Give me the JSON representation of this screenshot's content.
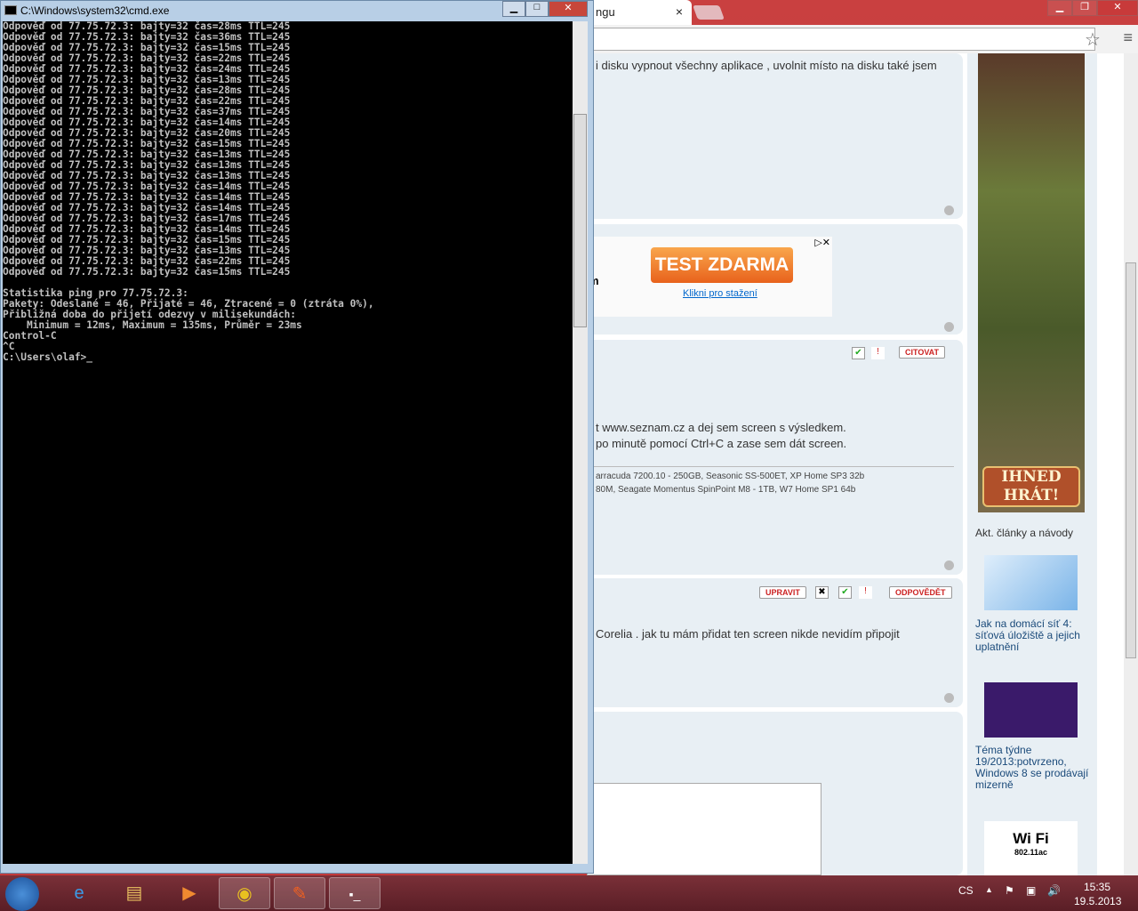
{
  "browser": {
    "tab_title": "ngu",
    "tab_close": "×",
    "post1_text": "i disku vypnout všechny aplikace , uvolnit místo na disku také jsem",
    "ad": {
      "button": "TEST ZDARMA",
      "link": "Klikni pro stažení",
      "partial": "m"
    },
    "post2": {
      "line1": "t www.seznam.cz a dej sem screen s výsledkem.",
      "line2": "po minutě pomocí Ctrl+C a zase sem dát screen.",
      "sig1": "arracuda 7200.10 - 250GB, Seasonic SS-500ET, XP Home SP3 32b",
      "sig2": "80M, Seagate Momentus SpinPoint M8 - 1TB, W7 Home SP1 64b",
      "quote": "CITOVAT"
    },
    "post3": {
      "text": "Corelia . jak tu mám přidat ten screen nikde nevidím připojit",
      "edit": "UPRAVIT",
      "reply": "ODPOVĚDĚT"
    },
    "sidebar": {
      "game_button": "IHNED HRÁT!",
      "heading": "Akt. články a návody",
      "articles": [
        "Jak na domácí síť 4: síťová úložiště a jejich uplatnění",
        "Téma týdne 19/2013:potvrzeno, Windows 8 se prodávají mizerně"
      ],
      "wifi": "Wi Fi",
      "wifi_sub": "802.11ac"
    }
  },
  "cmd": {
    "title": "C:\\Windows\\system32\\cmd.exe",
    "ip": "77.75.72.3",
    "times": [
      28,
      36,
      15,
      22,
      24,
      13,
      28,
      22,
      37,
      14,
      20,
      15,
      13,
      13,
      13,
      14,
      14,
      14,
      17,
      14,
      15,
      13,
      22,
      15
    ],
    "tail": [
      "",
      "Statistika ping pro 77.75.72.3:",
      "Pakety: Odeslané = 46, Přijaté = 46, Ztracené = 0 (ztráta 0%),",
      "Přibližná doba do přijetí odezvy v milisekundách:",
      "    Minimum = 12ms, Maximum = 135ms, Průměr = 23ms",
      "Control-C",
      "^C",
      "C:\\Users\\olaf>_"
    ]
  },
  "taskbar": {
    "lang": "CS",
    "time": "15:35",
    "date": "19.5.2013"
  }
}
